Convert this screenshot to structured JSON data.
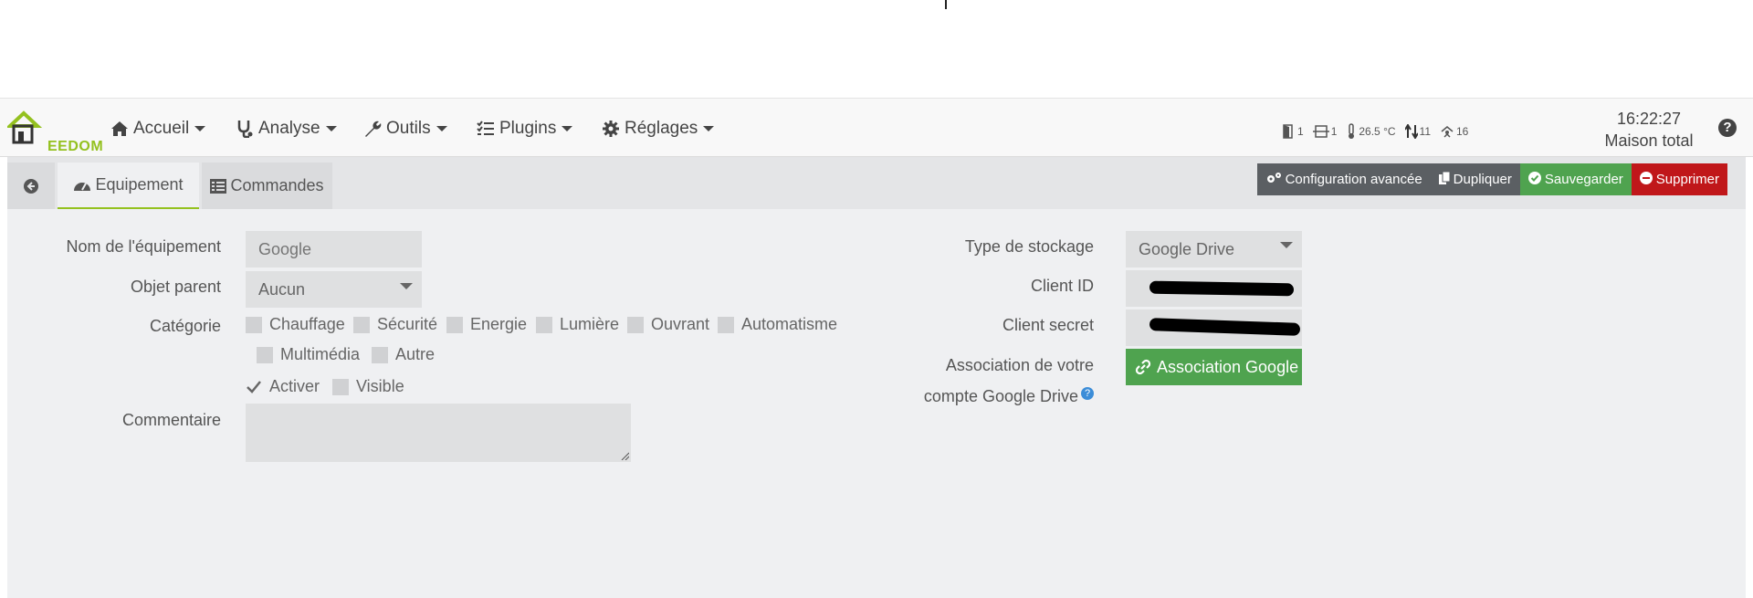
{
  "navbar": {
    "logo_text": "EEDOM",
    "items": [
      {
        "label": "Accueil",
        "icon": "home-icon"
      },
      {
        "label": "Analyse",
        "icon": "stethoscope-icon"
      },
      {
        "label": "Outils",
        "icon": "wrench-icon"
      },
      {
        "label": "Plugins",
        "icon": "tasks-icon"
      },
      {
        "label": "Réglages",
        "icon": "gear-icon"
      }
    ],
    "summary": [
      {
        "icon": "door-icon",
        "value": "1"
      },
      {
        "icon": "window-icon",
        "value": "1"
      },
      {
        "icon": "thermometer-icon",
        "value": "26.5 °C"
      },
      {
        "icon": "arrows-updown-icon",
        "value": "11"
      },
      {
        "icon": "motion-icon",
        "value": "16"
      }
    ],
    "time": "16:22:27",
    "object": "Maison total"
  },
  "tabs": {
    "equipement": "Equipement",
    "commandes": "Commandes"
  },
  "actions": {
    "config": "Configuration avancée",
    "duplicate": "Dupliquer",
    "save": "Sauvegarder",
    "delete": "Supprimer"
  },
  "form": {
    "name_label": "Nom de l'équipement",
    "name_placeholder": "Google",
    "parent_label": "Objet parent",
    "parent_value": "Aucun",
    "category_label": "Catégorie",
    "categories": [
      "Chauffage",
      "Sécurité",
      "Energie",
      "Lumière",
      "Ouvrant",
      "Automatisme",
      "Multimédia",
      "Autre"
    ],
    "activate": "Activer",
    "visible": "Visible",
    "comment_label": "Commentaire",
    "storage_label": "Type de stockage",
    "storage_value": "Google Drive",
    "client_id_label": "Client ID",
    "client_id_value": "",
    "client_secret_label": "Client secret",
    "client_secret_value": "",
    "assoc_label_1": "Association de votre",
    "assoc_label_2": "compte Google Drive",
    "assoc_button": "Association Google Drive"
  },
  "colors": {
    "accent": "#94c11f",
    "green": "#4fa34f",
    "red": "#c0171a",
    "gray": "#5b5f63"
  }
}
